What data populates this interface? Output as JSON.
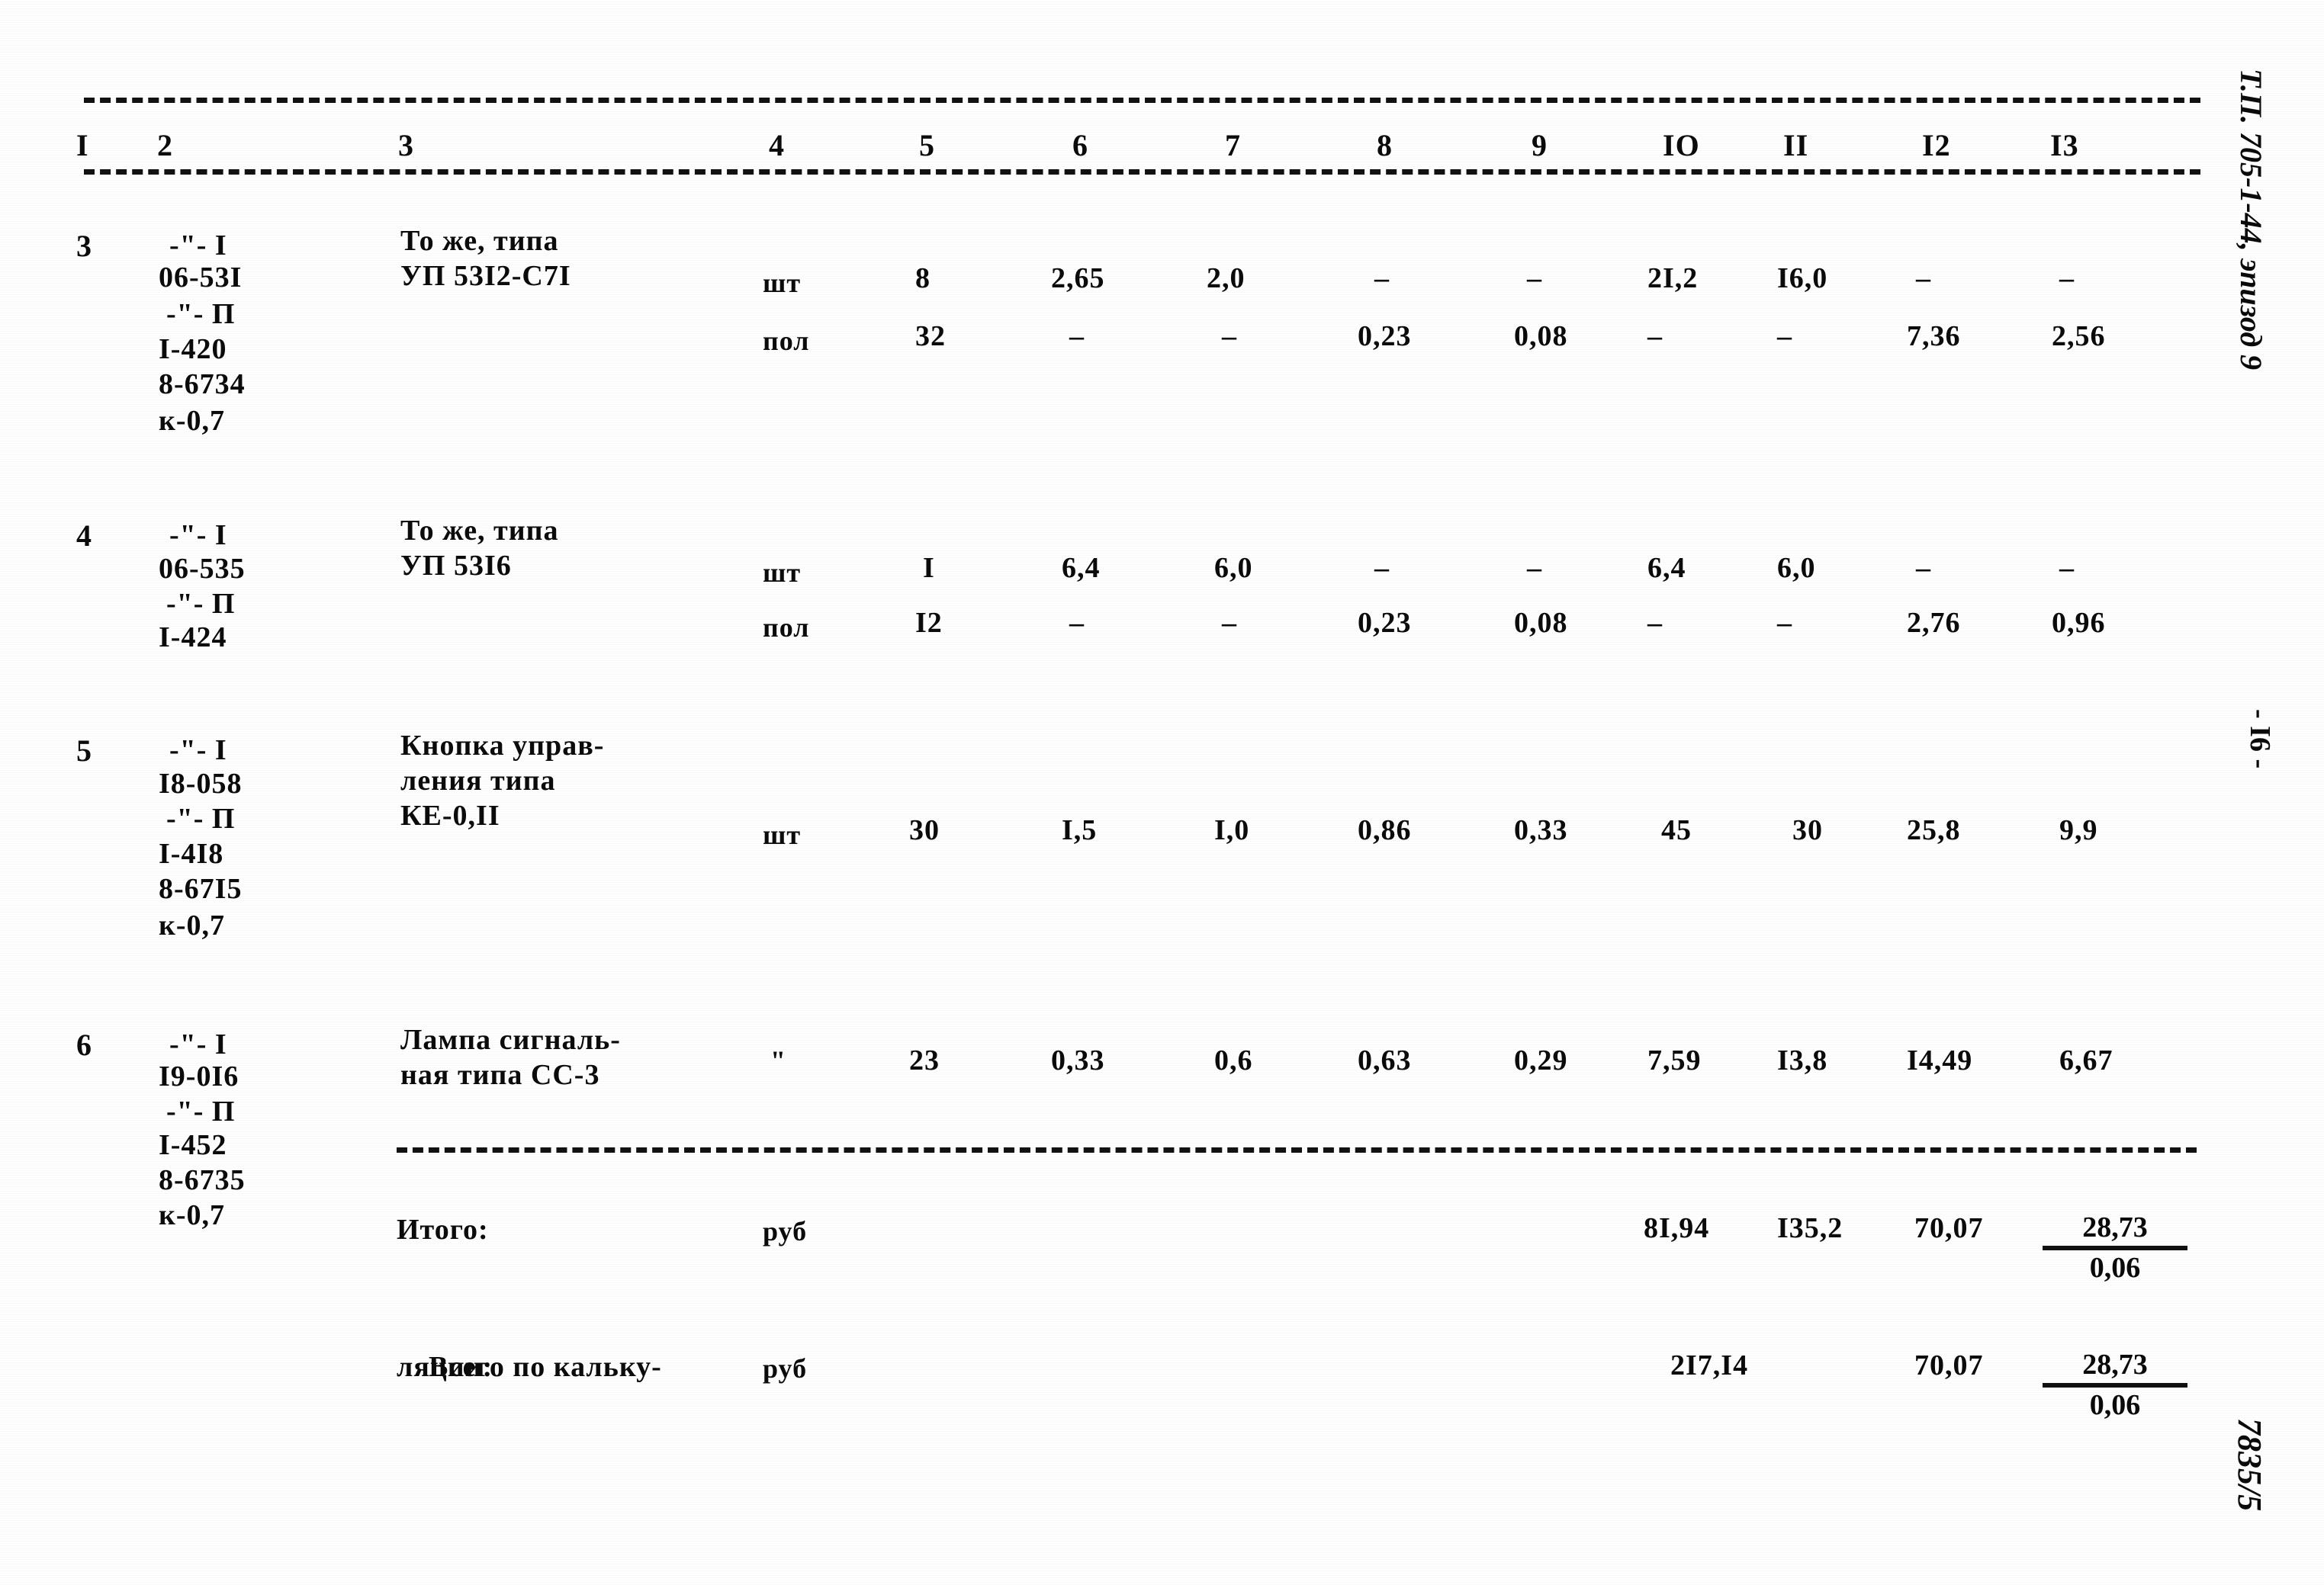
{
  "document": {
    "margin_reference": "Т.П. 705-1-44, эпизод 9",
    "page_number": "- I6 -",
    "stamp": "7835/5"
  },
  "table": {
    "column_headers": [
      "I",
      "2",
      "3",
      "4",
      "5",
      "6",
      "7",
      "8",
      "9",
      "IO",
      "II",
      "I2",
      "I3"
    ],
    "rows": [
      {
        "num": "3",
        "codes": [
          "-\"- I",
          "06-53I",
          "-\"- П",
          "I-420",
          "8-6734",
          "к-0,7"
        ],
        "description": [
          "То же, типа",
          "УП 53I2-С7I"
        ],
        "lines": [
          {
            "unit": "шт",
            "c5": "8",
            "c6": "2,65",
            "c7": "2,0",
            "c8": "–",
            "c9": "–",
            "c10": "2I,2",
            "c11": "I6,0",
            "c12": "–",
            "c13": "–"
          },
          {
            "unit": "пол",
            "c5": "32",
            "c6": "–",
            "c7": "–",
            "c8": "0,23",
            "c9": "0,08",
            "c10": "–",
            "c11": "–",
            "c12": "7,36",
            "c13": "2,56"
          }
        ]
      },
      {
        "num": "4",
        "codes": [
          "-\"- I",
          "06-535",
          "-\"- П",
          "I-424"
        ],
        "description": [
          "То же, типа",
          "УП 53I6"
        ],
        "lines": [
          {
            "unit": "шт",
            "c5": "I",
            "c6": "6,4",
            "c7": "6,0",
            "c8": "–",
            "c9": "–",
            "c10": "6,4",
            "c11": "6,0",
            "c12": "–",
            "c13": "–"
          },
          {
            "unit": "пол",
            "c5": "I2",
            "c6": "–",
            "c7": "–",
            "c8": "0,23",
            "c9": "0,08",
            "c10": "–",
            "c11": "–",
            "c12": "2,76",
            "c13": "0,96"
          }
        ]
      },
      {
        "num": "5",
        "codes": [
          "-\"- I",
          "I8-058",
          "-\"- П",
          "I-4I8",
          "8-67I5",
          "к-0,7"
        ],
        "description": [
          "Кнопка управ-",
          "ления типа",
          "КЕ-0,II"
        ],
        "lines": [
          {
            "unit": "шт",
            "c5": "30",
            "c6": "I,5",
            "c7": "I,0",
            "c8": "0,86",
            "c9": "0,33",
            "c10": "45",
            "c11": "30",
            "c12": "25,8",
            "c13": "9,9"
          }
        ]
      },
      {
        "num": "6",
        "codes": [
          "-\"- I",
          "I9-0I6",
          "-\"- П",
          "I-452",
          "8-6735",
          "к-0,7"
        ],
        "description": [
          "Лампа сигналь-",
          "ная типа СС-3"
        ],
        "lines": [
          {
            "unit": "\"",
            "c5": "23",
            "c6": "0,33",
            "c7": "0,6",
            "c8": "0,63",
            "c9": "0,29",
            "c10": "7,59",
            "c11": "I3,8",
            "c12": "I4,49",
            "c13": "6,67"
          }
        ]
      }
    ],
    "totals": [
      {
        "label_lines": [
          "Итого:"
        ],
        "unit": "руб",
        "c10": "8I,94",
        "c11": "I35,2",
        "c12": "70,07",
        "c13_top": "28,73",
        "c13_bottom": "0,06"
      },
      {
        "label_lines": [
          "Всего по кальку-",
          "ляции:"
        ],
        "label_bold": "кальку-",
        "unit": "руб",
        "c10": "2I7,I4",
        "c11": "",
        "c12": "70,07",
        "c13_top": "28,73",
        "c13_bottom": "0,06"
      }
    ]
  }
}
